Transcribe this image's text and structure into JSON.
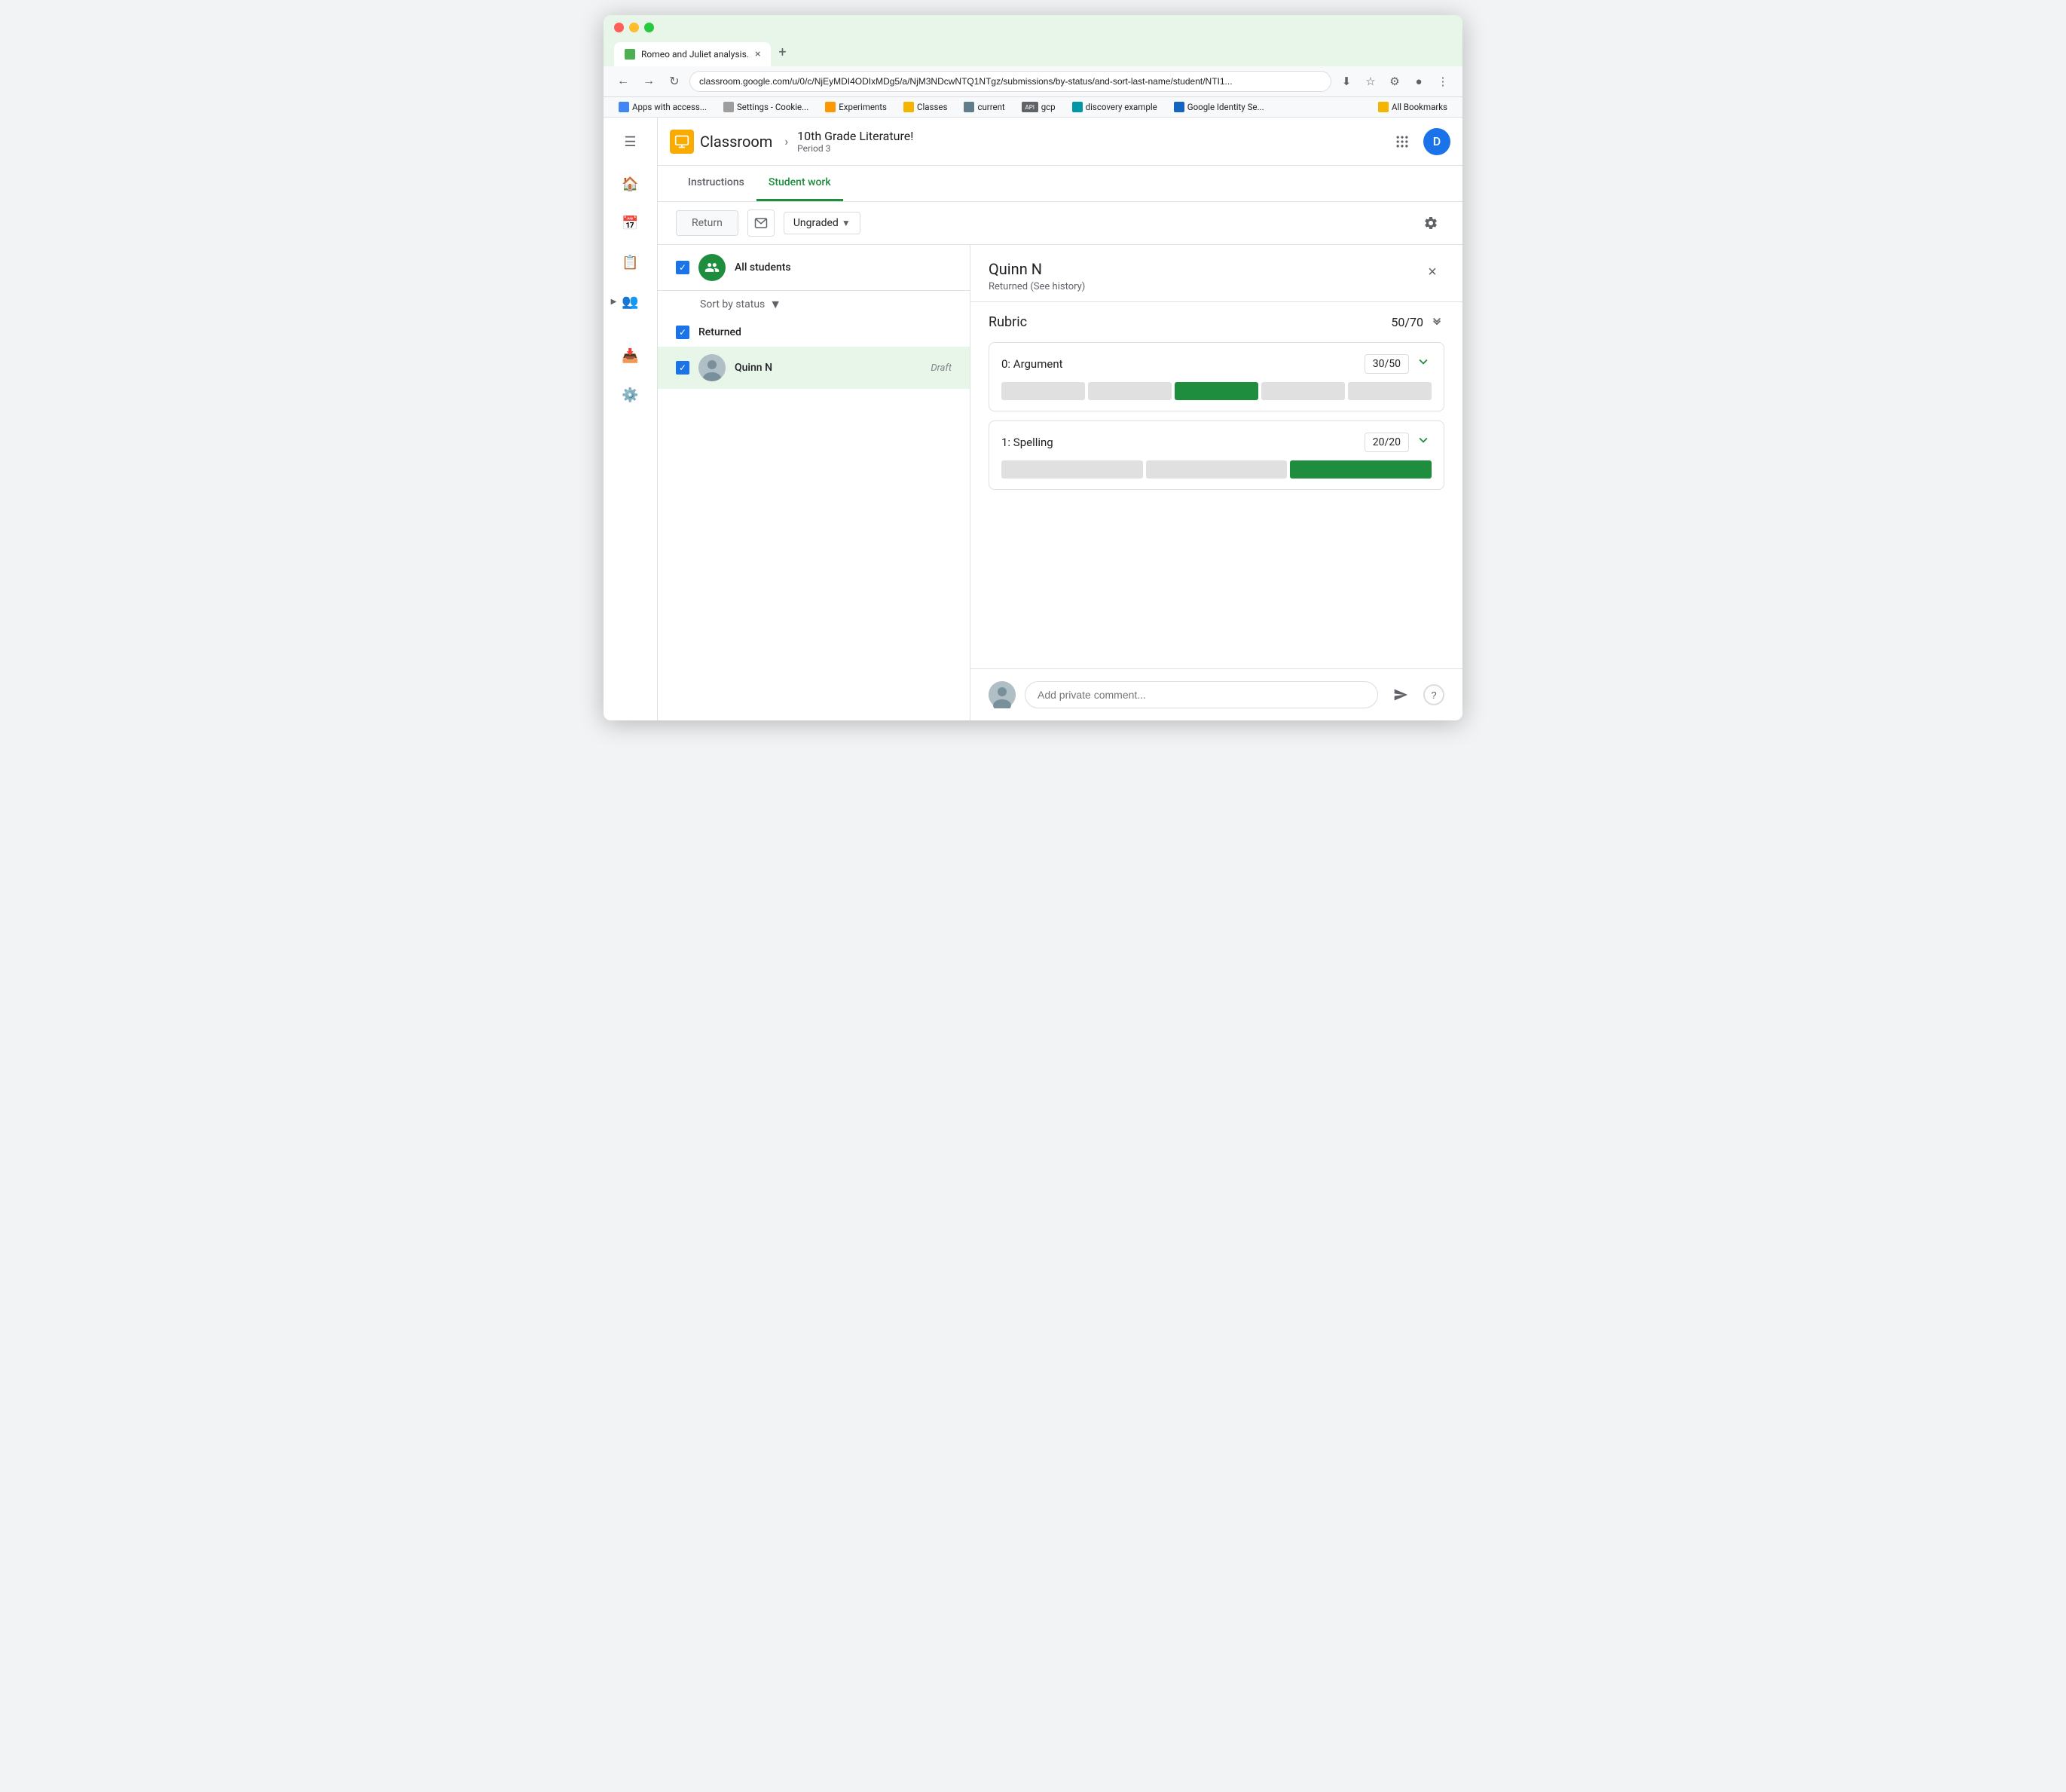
{
  "browser": {
    "tab_title": "Romeo and Juliet analysis.",
    "tab_close": "×",
    "tab_new": "+",
    "address": "classroom.google.com/u/0/c/NjEyMDI4ODIxMDg5/a/NjM3NDcwNTQ1NTgz/submissions/by-status/and-sort-last-name/student/NTI1...",
    "bookmarks": [
      {
        "label": "Apps with access...",
        "type": "google"
      },
      {
        "label": "Settings - Cookie...",
        "type": "settings"
      },
      {
        "label": "Experiments",
        "type": "experiments"
      },
      {
        "label": "Classes",
        "type": "classes"
      },
      {
        "label": "current",
        "type": "current"
      },
      {
        "label": "gcp",
        "type": "api"
      },
      {
        "label": "discovery example",
        "type": "discovery"
      },
      {
        "label": "Google Identity Se...",
        "type": "google-id"
      },
      {
        "label": "All Bookmarks",
        "type": "all"
      }
    ]
  },
  "app": {
    "classroom_label": "Classroom",
    "course_title": "10th Grade Literature!",
    "course_period": "Period 3",
    "avatar_initial": "D"
  },
  "tabs": {
    "instructions_label": "Instructions",
    "student_work_label": "Student work"
  },
  "toolbar": {
    "return_label": "Return",
    "grade_label": "Ungraded",
    "settings_label": "Settings"
  },
  "student_list": {
    "all_students_label": "All students",
    "sort_label": "Sort by status",
    "status_group": "Returned",
    "students": [
      {
        "name": "Quinn N",
        "status": "Draft"
      }
    ]
  },
  "detail": {
    "student_name": "Quinn N",
    "student_status": "Returned (See history)",
    "rubric_title": "Rubric",
    "rubric_total": "50/70",
    "criteria": [
      {
        "id": "0",
        "name": "Argument",
        "score": "30/50",
        "segments": [
          "empty",
          "empty",
          "selected",
          "empty",
          "empty"
        ],
        "segment_count": 5,
        "selected_index": 2
      },
      {
        "id": "1",
        "name": "Spelling",
        "score": "20/20",
        "segments": [
          "empty",
          "empty",
          "selected"
        ],
        "segment_count": 3,
        "selected_index": 2
      }
    ]
  },
  "comment": {
    "placeholder": "Add private comment..."
  },
  "sidebar_nav": [
    {
      "icon": "🏠",
      "label": "Home"
    },
    {
      "icon": "📅",
      "label": "Calendar"
    },
    {
      "icon": "📋",
      "label": "To-do"
    },
    {
      "icon": "👥",
      "label": "People"
    },
    {
      "icon": "📤",
      "label": "Archive"
    },
    {
      "icon": "⚙️",
      "label": "Settings"
    }
  ]
}
